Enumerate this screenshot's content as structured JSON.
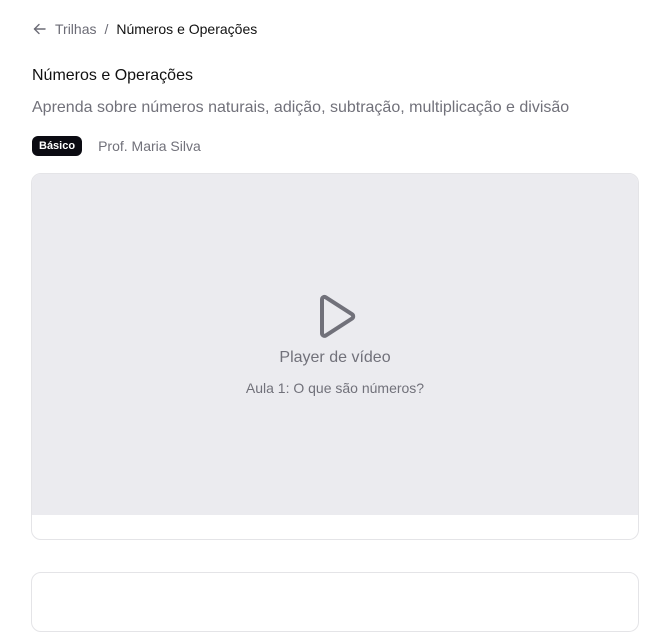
{
  "breadcrumb": {
    "back_icon": "arrow-left-icon",
    "parent": "Trilhas",
    "separator": "/",
    "current": "Números e Operações"
  },
  "page": {
    "title": "Números e Operações",
    "subtitle": "Aprenda sobre números naturais, adição, subtração, multiplicação e divisão"
  },
  "meta": {
    "level": "Básico",
    "instructor": "Prof. Maria Silva"
  },
  "video": {
    "play_icon": "play-icon",
    "label": "Player de vídeo",
    "lesson": "Aula 1: O que são números?"
  },
  "colors": {
    "badge_bg": "#0b0b12",
    "player_bg": "#ebebef",
    "muted_text": "#71717a",
    "border": "#e4e4e7"
  }
}
